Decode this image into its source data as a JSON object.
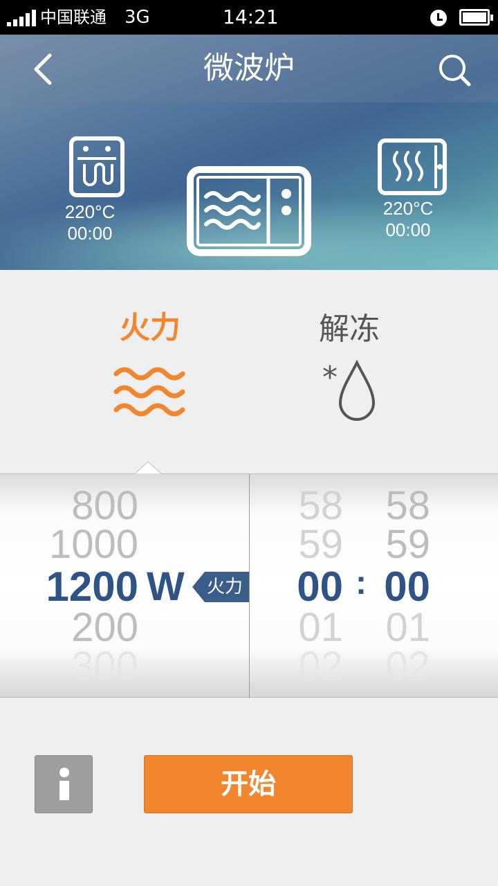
{
  "status_bar": {
    "carrier": "中国联通",
    "network": "3G",
    "time": "14:21"
  },
  "header": {
    "title": "微波炉",
    "back_icon": "back-arrow-icon",
    "search_icon": "search-icon"
  },
  "devices": [
    {
      "name": "oven-left",
      "icon": "steam-oven-icon",
      "temp": "220°C",
      "time": "00:00"
    },
    {
      "name": "microwave",
      "icon": "microwave-icon"
    },
    {
      "name": "oven-right",
      "icon": "oven-heat-icon",
      "temp": "220°C",
      "time": "00:00"
    }
  ],
  "modes": {
    "fire": {
      "label": "火力",
      "icon": "wave-icon",
      "color": "#f2862e",
      "selected": true
    },
    "thaw": {
      "label": "解冻",
      "icon": "snow-drop-icon",
      "selected": false
    }
  },
  "power_picker": {
    "values": [
      "800",
      "1000",
      "1200",
      "200",
      "300"
    ],
    "selected": "1200",
    "unit": "W",
    "tag": "火力"
  },
  "time_picker": {
    "minutes": [
      "58",
      "59",
      "00",
      "01",
      "02"
    ],
    "seconds": [
      "58",
      "59",
      "00",
      "01",
      "02"
    ],
    "separator": ":"
  },
  "actions": {
    "info_icon": "info-icon",
    "start_label": "开始",
    "accent": "#f2862e",
    "primary_text": "#2e5384"
  }
}
